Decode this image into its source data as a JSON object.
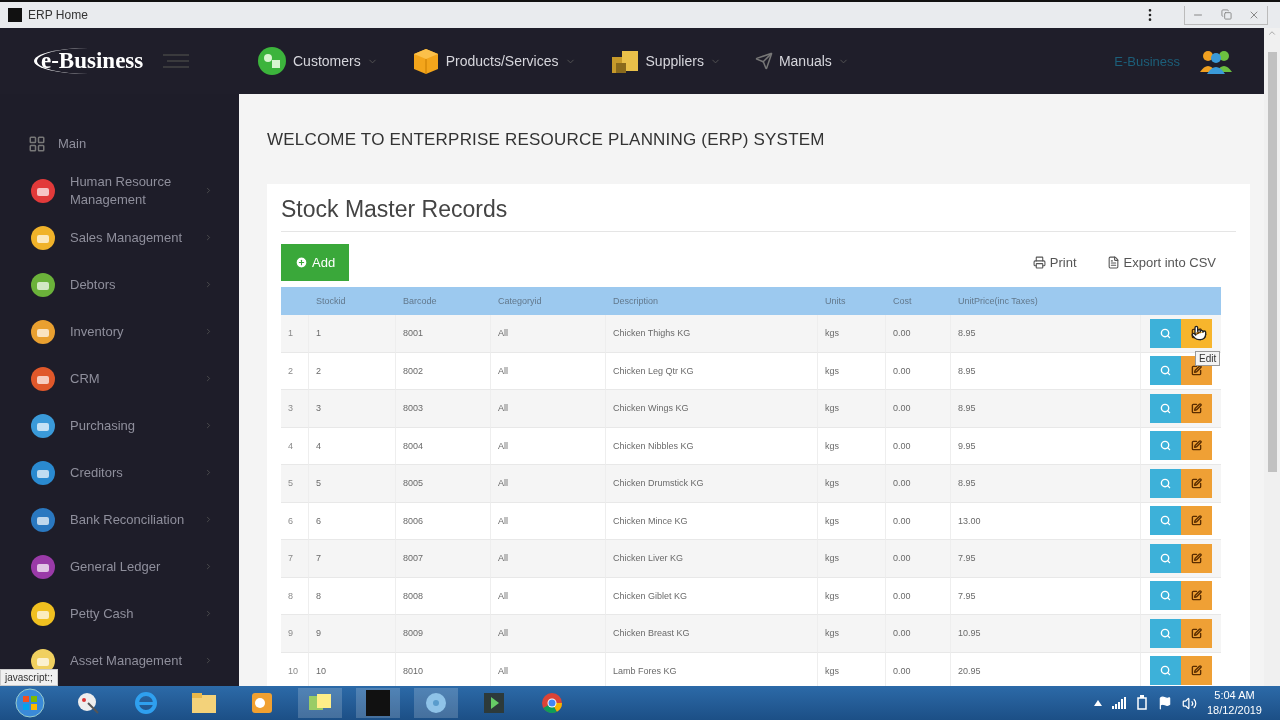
{
  "window": {
    "title": "ERP Home"
  },
  "header": {
    "logo": "e-Business",
    "nav": [
      {
        "label": "Customers",
        "kind": "people"
      },
      {
        "label": "Products/Services",
        "kind": "box"
      },
      {
        "label": "Suppliers",
        "kind": "crates"
      },
      {
        "label": "Manuals",
        "kind": "plane"
      }
    ],
    "user_label": "E-Business"
  },
  "sidebar": {
    "items": [
      {
        "label": "Main",
        "has_submenu": false
      },
      {
        "label": "Human Resource Management",
        "has_submenu": true
      },
      {
        "label": "Sales Management",
        "has_submenu": true
      },
      {
        "label": "Debtors",
        "has_submenu": true
      },
      {
        "label": "Inventory",
        "has_submenu": true
      },
      {
        "label": "CRM",
        "has_submenu": true
      },
      {
        "label": "Purchasing",
        "has_submenu": true
      },
      {
        "label": "Creditors",
        "has_submenu": true
      },
      {
        "label": "Bank Reconciliation",
        "has_submenu": true
      },
      {
        "label": "General Ledger",
        "has_submenu": true
      },
      {
        "label": "Petty Cash",
        "has_submenu": true
      },
      {
        "label": "Asset Management",
        "has_submenu": true
      }
    ]
  },
  "page": {
    "heading": "WELCOME TO ENTERPRISE RESOURCE PLANNING (ERP) SYSTEM",
    "card_title": "Stock Master Records",
    "add_button": "Add",
    "print_button": "Print",
    "export_button": "Export into CSV"
  },
  "table": {
    "columns": [
      "Stockid",
      "Barcode",
      "Categoryid",
      "Description",
      "Units",
      "Cost",
      "UnitPrice(inc Taxes)"
    ],
    "tooltip": "Edit",
    "rows": [
      {
        "index": "1",
        "cells": [
          "1",
          "8001",
          "All",
          "Chicken Thighs KG",
          "kgs",
          "0.00",
          "8.95"
        ],
        "hovered": true
      },
      {
        "index": "2",
        "cells": [
          "2",
          "8002",
          "All",
          "Chicken Leg Qtr KG",
          "kgs",
          "0.00",
          "8.95"
        ],
        "hovered": false
      },
      {
        "index": "3",
        "cells": [
          "3",
          "8003",
          "All",
          "Chicken Wings KG",
          "kgs",
          "0.00",
          "8.95"
        ],
        "hovered": false
      },
      {
        "index": "4",
        "cells": [
          "4",
          "8004",
          "All",
          "Chicken Nibbles KG",
          "kgs",
          "0.00",
          "9.95"
        ],
        "hovered": false
      },
      {
        "index": "5",
        "cells": [
          "5",
          "8005",
          "All",
          "Chicken Drumstick KG",
          "kgs",
          "0.00",
          "8.95"
        ],
        "hovered": false
      },
      {
        "index": "6",
        "cells": [
          "6",
          "8006",
          "All",
          "Chicken Mince KG",
          "kgs",
          "0.00",
          "13.00"
        ],
        "hovered": false
      },
      {
        "index": "7",
        "cells": [
          "7",
          "8007",
          "All",
          "Chicken Liver KG",
          "kgs",
          "0.00",
          "7.95"
        ],
        "hovered": false
      },
      {
        "index": "8",
        "cells": [
          "8",
          "8008",
          "All",
          "Chicken Giblet KG",
          "kgs",
          "0.00",
          "7.95"
        ],
        "hovered": false
      },
      {
        "index": "9",
        "cells": [
          "9",
          "8009",
          "All",
          "Chicken Breast KG",
          "kgs",
          "0.00",
          "10.95"
        ],
        "hovered": false
      },
      {
        "index": "10",
        "cells": [
          "10",
          "8010",
          "All",
          "Lamb Fores KG",
          "kgs",
          "0.00",
          "20.95"
        ],
        "hovered": false
      }
    ]
  },
  "status_url": "javascript:;",
  "taskbar": {
    "time": "5:04 AM",
    "date": "18/12/2019"
  }
}
